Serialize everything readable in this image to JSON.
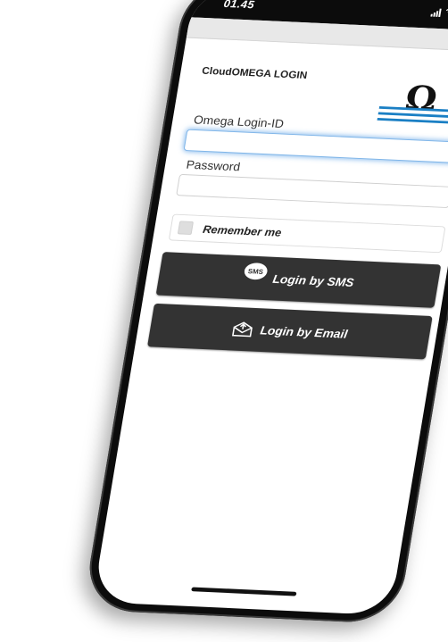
{
  "status_bar": {
    "time": "01.45"
  },
  "app": {
    "title": "CloudOMEGA LOGIN",
    "logo_letter": "Ω",
    "logo_color": "#1a7fc4"
  },
  "login_form": {
    "login_id_label": "Omega Login-ID",
    "login_id_value": "",
    "password_label": "Password",
    "password_value": "",
    "remember_label": "Remember me",
    "remember_checked": false
  },
  "buttons": {
    "sms_label": "Login by SMS",
    "sms_icon_text": "SMS",
    "email_label": "Login by Email"
  },
  "colors": {
    "button_bg": "#333333",
    "focus_glow": "#7db4e8"
  }
}
